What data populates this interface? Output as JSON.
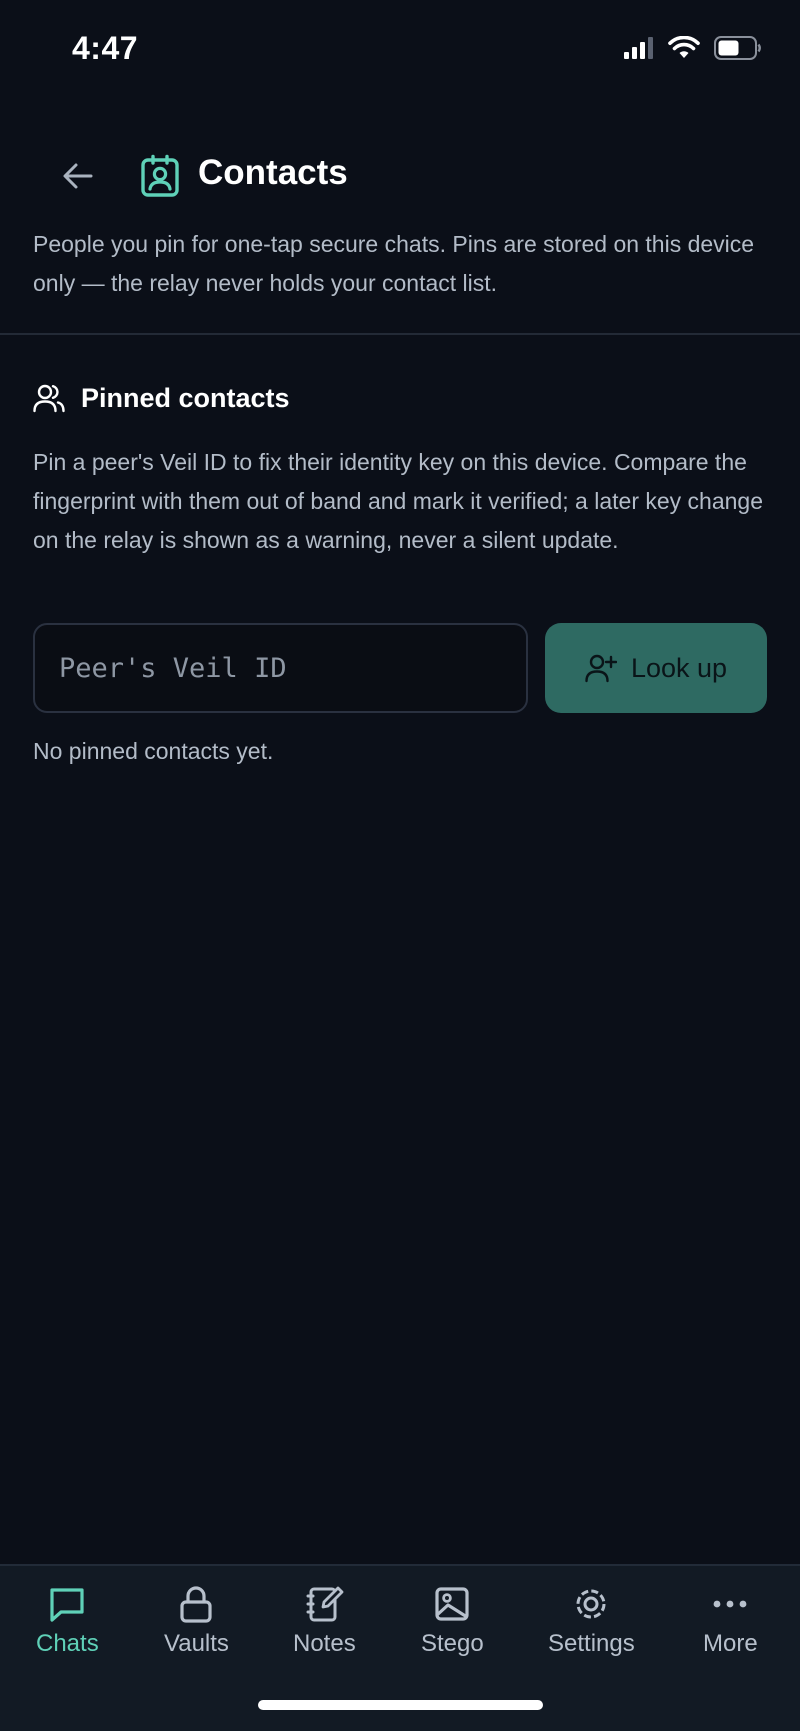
{
  "status": {
    "time": "4:47"
  },
  "header": {
    "title": "Contacts"
  },
  "intro": "People you pin for one-tap secure chats. Pins are stored on this device only — the relay never holds your contact list.",
  "section": {
    "title": "Pinned contacts",
    "description": "Pin a peer's Veil ID to fix their identity key on this device. Compare the fingerprint with them out of band and mark it verified; a later key change on the relay is shown as a warning, never a silent update."
  },
  "lookup": {
    "placeholder": "Peer's Veil ID",
    "value": "",
    "button_label": "Look up"
  },
  "empty_state": "No pinned contacts yet.",
  "nav": {
    "chats": "Chats",
    "vaults": "Vaults",
    "notes": "Notes",
    "stego": "Stego",
    "settings": "Settings",
    "more": "More"
  },
  "icons": {
    "back": "arrow-left-icon",
    "title": "contact-badge-icon",
    "section": "users-icon",
    "lookup": "user-plus-icon"
  },
  "colors": {
    "background": "#0b0f18",
    "accent": "#5fd1b8",
    "button": "#2e6a62",
    "text_muted": "#b3bcc8"
  }
}
